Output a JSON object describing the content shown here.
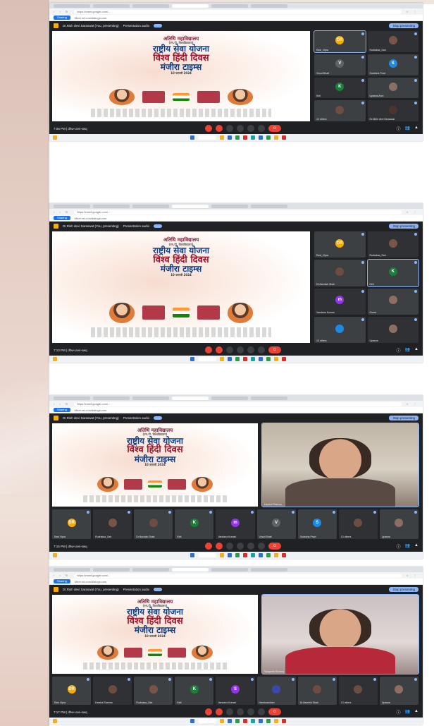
{
  "page": {
    "accent_brand": "#d9c0b6",
    "meet_bg": "#202124"
  },
  "browser": {
    "url": "https://meet.google.com/...",
    "bookmark_pill": "Sharing",
    "bookmark_text": "Meet.ed.com/dialogs.com"
  },
  "meeting": {
    "top_title": "Dr.Rish devi Saraswat (You, presenting)",
    "top_sub": "Presentation audio",
    "stop_presenting": "Stop presenting",
    "end_label": "⏻"
  },
  "slide": {
    "line1": "अतिथि महाविद्यालय",
    "line2": "(एम.पी. विश्वविद्यालय)",
    "line3": "राष्ट्रीय सेवा योजना",
    "line4": "विश्व हिंदी दिवस",
    "line5": "मंजीरा टाइम्स",
    "line6": "10 जनवरी 2024"
  },
  "screenshots": [
    {
      "time": "7:08 PM | dhw-uvvi-swq",
      "tiles": [
        {
          "initial": "DR",
          "name": "Ravi_Vipra",
          "color": "#f9ab00"
        },
        {
          "initial": "",
          "name": "Rudraksa_Sah",
          "color": "#795548"
        },
        {
          "initial": "V",
          "name": "Vinod Bhatt",
          "color": "#5f6368"
        },
        {
          "initial": "S",
          "name": "Sudesha Pravi",
          "color": "#1e88e5"
        },
        {
          "initial": "K",
          "name": "Kirti",
          "color": "#188038"
        },
        {
          "initial": "",
          "name": "Upasna Anni",
          "color": "#8d6e63"
        },
        {
          "initial": "",
          "name": "13 others",
          "color": "#6d4c41"
        },
        {
          "initial": "",
          "name": "Dr.Nidhi devi Saraswat",
          "color": "#4e342e"
        }
      ]
    },
    {
      "time": "7:13 PM | dhw-uvvi-swq",
      "tiles": [
        {
          "initial": "DR",
          "name": "Ravi_Vipra",
          "color": "#f9ab00"
        },
        {
          "initial": "",
          "name": "Rudraksa_Sah",
          "color": "#795548"
        },
        {
          "initial": "",
          "name": "Dr.Navnish Shah",
          "color": "#6d4c41"
        },
        {
          "initial": "K",
          "name": "Kirti",
          "color": "#188038"
        },
        {
          "initial": "m",
          "name": "Vandana Kumari",
          "color": "#9334e6"
        },
        {
          "initial": "",
          "name": "Guest",
          "color": "#8d6e63"
        },
        {
          "initial": "",
          "name": "13 others",
          "color": "#1e88e5"
        },
        {
          "initial": "",
          "name": "Upasna",
          "color": "#8d6e63"
        }
      ]
    },
    {
      "time": "7:15 PM | dhw-uvvi-swq",
      "speaker": "Harsha Sharma",
      "tiles": [
        {
          "initial": "DR",
          "name": "Ravi Vipra",
          "color": "#f9ab00"
        },
        {
          "initial": "",
          "name": "Rudraksa_Sah",
          "color": "#795548"
        },
        {
          "initial": "",
          "name": "Dr.Navnish Shah",
          "color": "#6d4c41"
        },
        {
          "initial": "K",
          "name": "Kirti",
          "color": "#188038"
        },
        {
          "initial": "m",
          "name": "Vandana Kumari",
          "color": "#9334e6"
        },
        {
          "initial": "V",
          "name": "Vinod Bhatt",
          "color": "#5f6368"
        },
        {
          "initial": "S",
          "name": "Sudesha Pravi",
          "color": "#1e88e5"
        },
        {
          "initial": "",
          "name": "13 others",
          "color": "#6d4c41"
        },
        {
          "initial": "",
          "name": "Upasna",
          "color": "#8d6e63"
        }
      ]
    },
    {
      "time": "7:17 PM | dhw-uvvi-swq",
      "speaker": "Sangeeta Sharma",
      "tiles": [
        {
          "initial": "DR",
          "name": "Ravi Vipra",
          "color": "#f9ab00"
        },
        {
          "initial": "",
          "name": "Harsha Sharma",
          "color": "#6d4c41"
        },
        {
          "initial": "",
          "name": "Rudraksa_Sah",
          "color": "#795548"
        },
        {
          "initial": "K",
          "name": "Kirti",
          "color": "#188038"
        },
        {
          "initial": "S",
          "name": "Vandana Kumari",
          "color": "#9334e6"
        },
        {
          "initial": "",
          "name": "Harshvardhan",
          "color": "#3949ab"
        },
        {
          "initial": "",
          "name": "Dr.Navnish Shah",
          "color": "#6d4c41"
        },
        {
          "initial": "",
          "name": "13 others",
          "color": "#6d4c41"
        },
        {
          "initial": "",
          "name": "Upasna",
          "color": "#8d6e63"
        }
      ]
    }
  ]
}
